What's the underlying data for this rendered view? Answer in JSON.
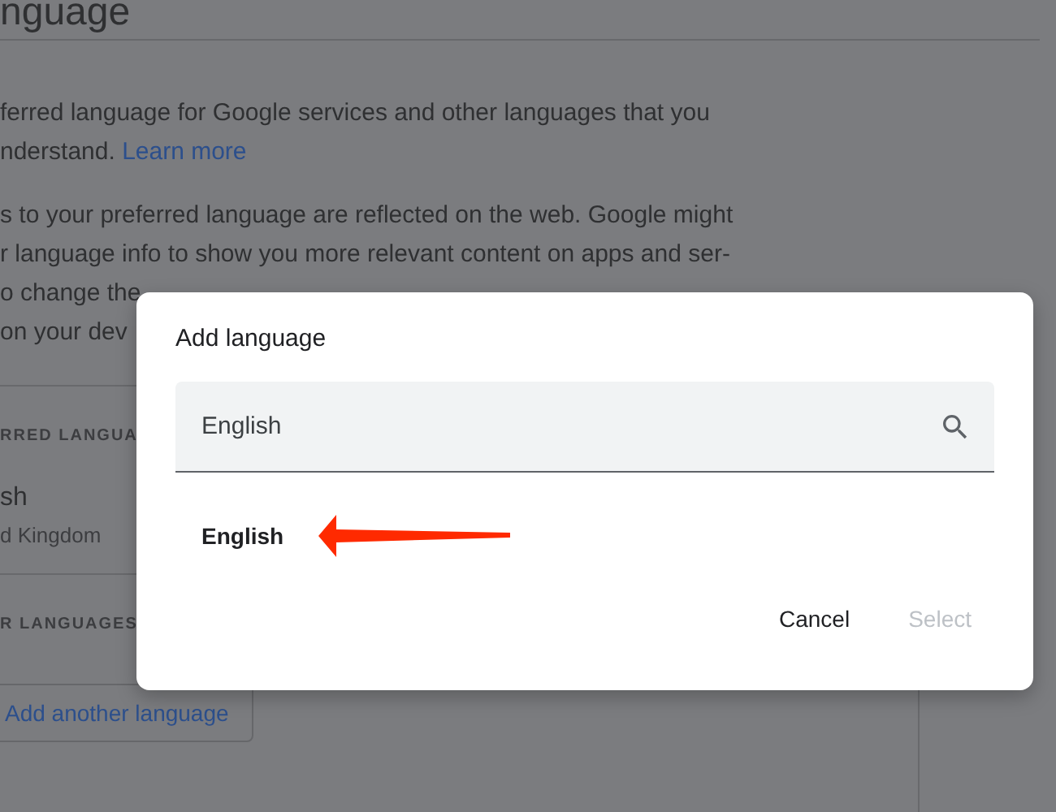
{
  "page": {
    "heading": "nguage",
    "intro": "ferred language for Google services and other languages that you",
    "intro_end": "nderstand.",
    "learn_more": "Learn more",
    "note_lines": [
      "s to your preferred language are reflected on the web. Google might",
      "r language info to show you more relevant content on apps and ser-",
      "o change the",
      "on your dev"
    ],
    "preferred_label": "RRED LANGUA",
    "preferred": {
      "name": "sh",
      "region": "d Kingdom"
    },
    "other_label": "R LANGUAGES",
    "add_button": "Add another language"
  },
  "dialog": {
    "title": "Add language",
    "search": {
      "value": "English"
    },
    "results": [
      {
        "label": "English"
      }
    ],
    "buttons": [
      {
        "label": "Cancel",
        "disabled": false
      },
      {
        "label": "Select",
        "disabled": true
      }
    ]
  }
}
